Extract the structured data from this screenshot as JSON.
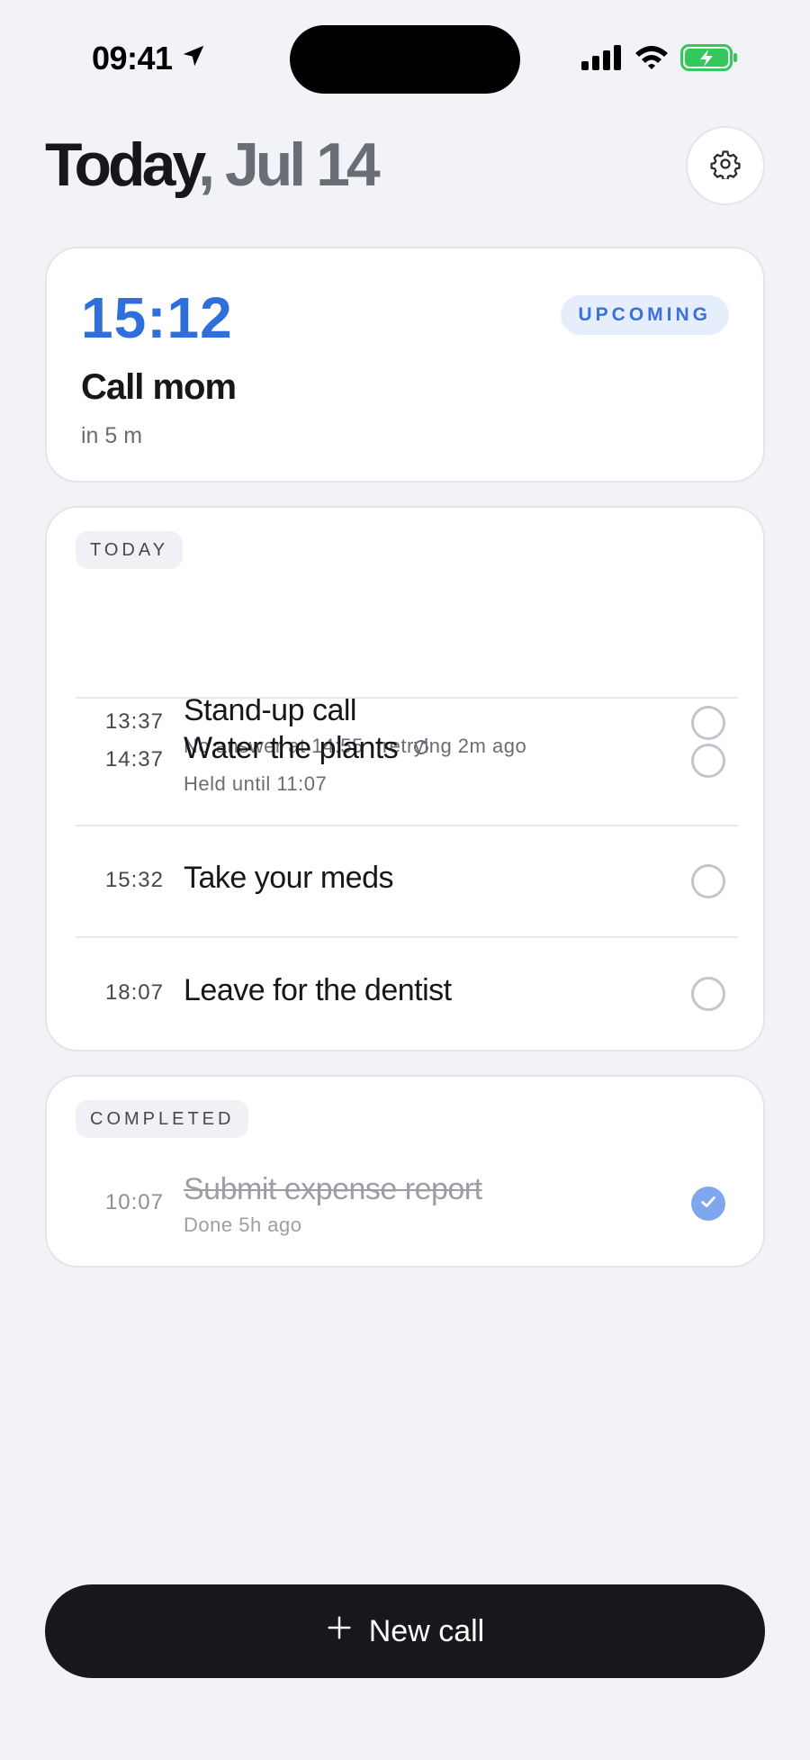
{
  "status_bar": {
    "time": "09:41",
    "icons": [
      "location-arrow-icon",
      "cellular-signal-icon",
      "wifi-icon",
      "battery-charging-icon"
    ]
  },
  "header": {
    "title_day": "Today",
    "title_date": ", Jul 14",
    "settings_icon": "gear-icon"
  },
  "next_call": {
    "time": "15:12",
    "badge": "UPCOMING",
    "title": "Call mom",
    "subtitle": "in 5 m"
  },
  "today": {
    "label": "TODAY",
    "items": [
      {
        "time": "13:37",
        "title": "Stand-up call",
        "subtitle": "No answer at 14:55 · retrying 2m ago",
        "checked": false
      },
      {
        "time": "14:37",
        "title": "Water the plants",
        "subtitle": "Held until 11:07",
        "repeat_icon": "repeat-icon",
        "checked": false
      },
      {
        "time": "15:32",
        "title": "Take your meds",
        "subtitle": "",
        "checked": false
      },
      {
        "time": "18:07",
        "title": "Leave for the dentist",
        "subtitle": "",
        "checked": false
      }
    ]
  },
  "completed": {
    "label": "COMPLETED",
    "items": [
      {
        "time": "10:07",
        "title": "Submit expense report",
        "subtitle": "Done 5h ago",
        "checked": true
      }
    ]
  },
  "new_call_button": {
    "label": "New call",
    "icon": "plus-icon"
  },
  "colors": {
    "accent": "#2f6fdc",
    "background": "#f2f3f7",
    "button_dark": "#17181c",
    "checked": "#7fa7ef"
  }
}
